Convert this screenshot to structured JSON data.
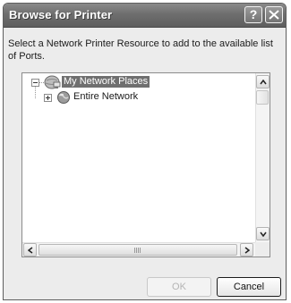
{
  "window": {
    "title": "Browse for Printer",
    "help_glyph": "?",
    "close_icon": "close-icon"
  },
  "instruction": "Select a Network Printer Resource to add to the available list of Ports.",
  "tree": {
    "items": [
      {
        "label": "My Network Places",
        "expanded": true,
        "selected": true,
        "icon": "network-places-icon",
        "level": 0
      },
      {
        "label": "Entire Network",
        "expanded": false,
        "selected": false,
        "icon": "globe-icon",
        "level": 1
      }
    ]
  },
  "buttons": {
    "ok": {
      "label": "OK",
      "enabled": false
    },
    "cancel": {
      "label": "Cancel",
      "enabled": true
    }
  }
}
